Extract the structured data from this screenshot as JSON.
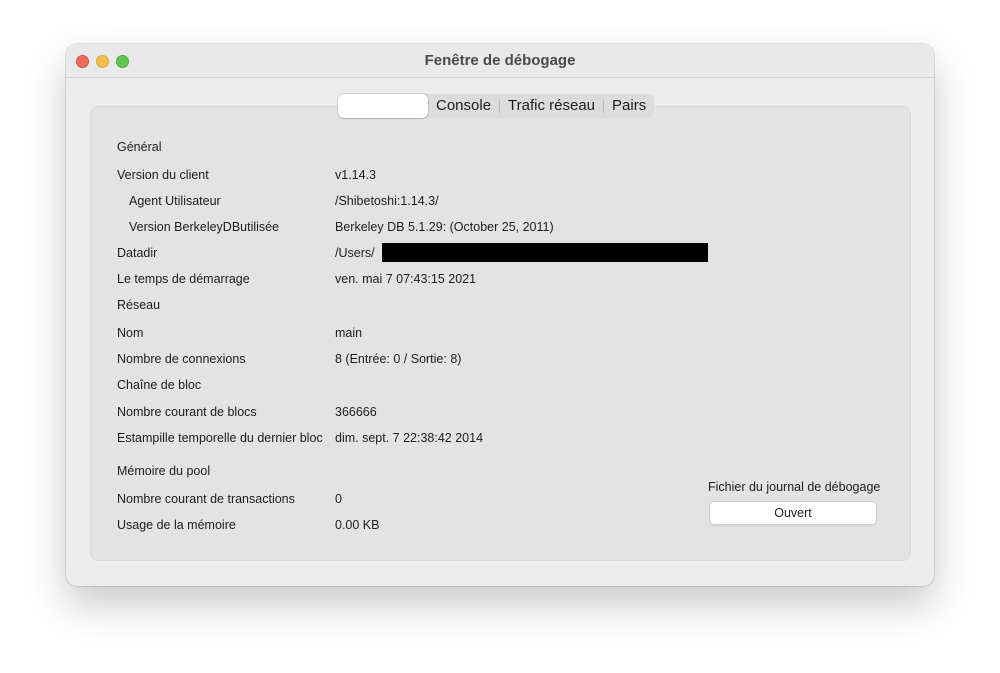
{
  "window": {
    "title": "Fenêtre de débogage"
  },
  "tabs": [
    {
      "label": ""
    },
    {
      "label": "Console"
    },
    {
      "label": "Trafic réseau"
    },
    {
      "label": "Pairs"
    }
  ],
  "info": {
    "general": "Général",
    "client_version_label": "Version du client",
    "client_version_value": "v1.14.3",
    "user_agent_label": "Agent Utilisateur",
    "user_agent_value": "/Shibetoshi:1.14.3/",
    "berkeley_label": "Version BerkeleyDButilisée",
    "berkeley_value": "Berkeley DB 5.1.29: (October 25, 2011)",
    "datadir_label": "Datadir",
    "datadir_value": "/Users/",
    "startup_label": "Le temps de démarrage",
    "startup_value": "ven. mai 7 07:43:15 2021",
    "network": "Réseau",
    "name_label": "Nom",
    "name_value": "main",
    "connections_label": "Nombre de connexions",
    "connections_value": "8 (Entrée: 0 / Sortie: 8)",
    "blockchain": "Chaîne de bloc",
    "blocks_label": "Nombre courant de blocs",
    "blocks_value": "366666",
    "last_block_label": "Estampille temporelle du dernier bloc",
    "last_block_value": "dim. sept. 7 22:38:42 2014",
    "mempool": "Mémoire du pool",
    "transactions_label": "Nombre courant de transactions",
    "transactions_value": "0",
    "memory_label": "Usage de la mémoire",
    "memory_value": "0.00 KB"
  },
  "debug_log": {
    "label": "Fichier du journal de débogage",
    "open_button": "Ouvert"
  }
}
